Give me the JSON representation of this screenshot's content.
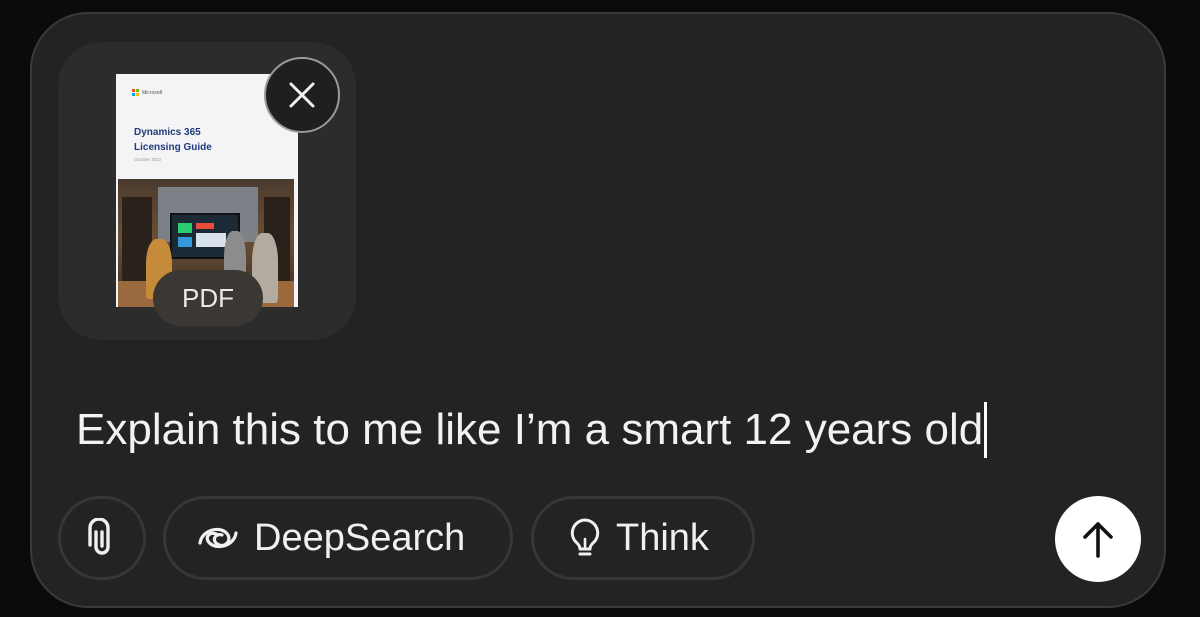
{
  "attachment": {
    "doc_brand": "Microsoft",
    "doc_title": "Dynamics 365\nLicensing Guide",
    "doc_date": "October 2022",
    "type_badge": "PDF",
    "remove_icon": "close-icon"
  },
  "input": {
    "value": "Explain this to me like I’m a smart 12 years old"
  },
  "toolbar": {
    "attach_icon": "paperclip-icon",
    "deepsearch_icon": "deepsearch-swirl-icon",
    "deepsearch_label": "DeepSearch",
    "think_icon": "lightbulb-icon",
    "think_label": "Think",
    "send_icon": "arrow-up-icon"
  },
  "colors": {
    "background": "#0b0b0b",
    "composer": "#232323",
    "send_button": "#ffffff",
    "doc_title": "#1d3a7a"
  }
}
